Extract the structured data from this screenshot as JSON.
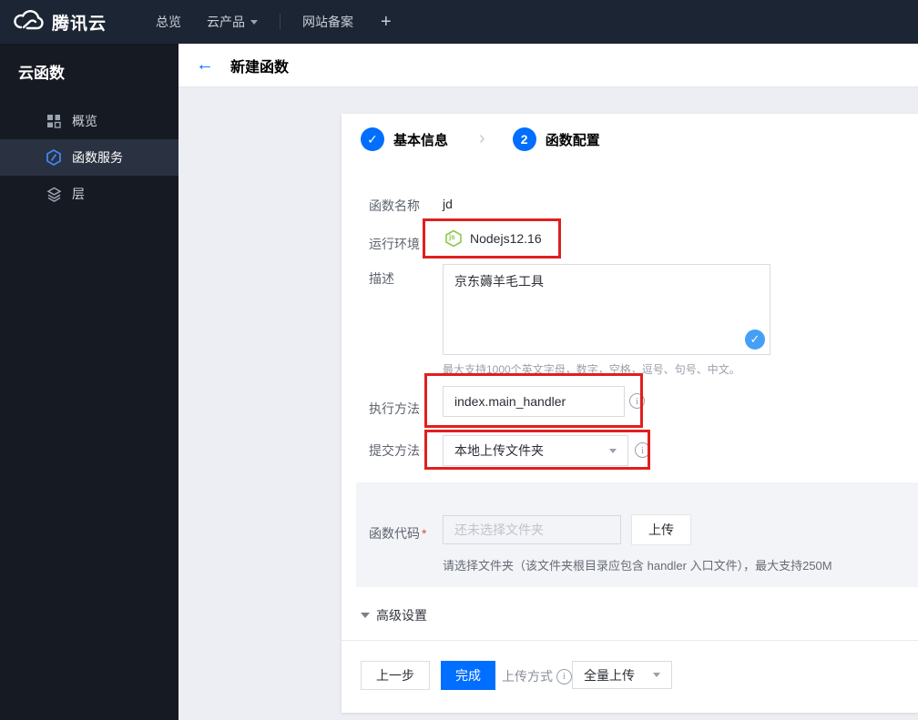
{
  "navbar": {
    "brand": "腾讯云",
    "items": [
      {
        "label": "总览",
        "has_caret": false
      },
      {
        "label": "云产品",
        "has_caret": true
      },
      {
        "label": "网站备案",
        "has_caret": false
      }
    ],
    "plus": "+"
  },
  "sidebar": {
    "title": "云函数",
    "items": [
      {
        "label": "概览",
        "icon": "grid-icon",
        "active": false
      },
      {
        "label": "函数服务",
        "icon": "scf-hexagon-icon",
        "active": true
      },
      {
        "label": "层",
        "icon": "layers-icon",
        "active": false
      }
    ]
  },
  "header": {
    "title": "新建函数"
  },
  "steps": [
    {
      "label": "基本信息",
      "state": "done"
    },
    {
      "label": "函数配置",
      "state": "current",
      "number": "2"
    }
  ],
  "form": {
    "function_name": {
      "label": "函数名称",
      "value": "jd"
    },
    "runtime": {
      "label": "运行环境",
      "value": "Nodejs12.16"
    },
    "description": {
      "label": "描述",
      "value": "京东薅羊毛工具",
      "hint": "最大支持1000个英文字母，数字，空格，逗号、句号、中文。"
    },
    "handler": {
      "label": "执行方法",
      "value": "index.main_handler"
    },
    "submit_method": {
      "label": "提交方法",
      "value": "本地上传文件夹"
    },
    "function_code": {
      "label": "函数代码",
      "required_mark": "*",
      "placeholder": "还未选择文件夹",
      "upload_button": "上传",
      "hint": "请选择文件夹（该文件夹根目录应包含 handler 入口文件），最大支持250M"
    },
    "advanced_toggle": "高级设置"
  },
  "footer": {
    "prev_button": "上一步",
    "finish_button": "完成",
    "upload_mode_label": "上传方式",
    "upload_mode_value": "全量上传"
  },
  "icons": {
    "check": "✓",
    "back_arrow": "←",
    "chevron": "›",
    "info": "i",
    "nodejs_label": "js"
  },
  "colors": {
    "accent_blue": "#006eff",
    "annotation_red": "#e01f1f",
    "node_green": "#8cc84b",
    "navbar_bg": "#1c2533",
    "sidebar_bg": "#161a23",
    "content_bg": "#eceef3"
  }
}
